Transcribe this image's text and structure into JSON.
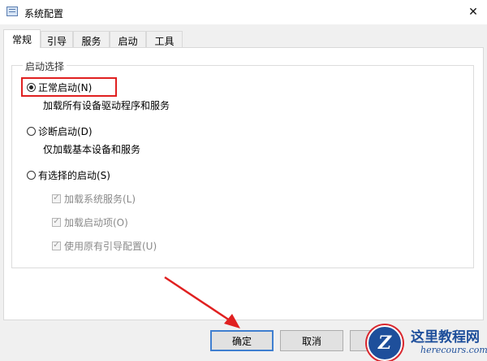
{
  "window": {
    "title": "系统配置",
    "close_glyph": "✕"
  },
  "tabs": [
    {
      "label": "常规",
      "active": true
    },
    {
      "label": "引导",
      "active": false
    },
    {
      "label": "服务",
      "active": false
    },
    {
      "label": "启动",
      "active": false
    },
    {
      "label": "工具",
      "active": false
    }
  ],
  "startup_selection": {
    "legend": "启动选择",
    "options": [
      {
        "label": "正常启动(N)",
        "description": "加载所有设备驱动程序和服务",
        "checked": true
      },
      {
        "label": "诊断启动(D)",
        "description": "仅加载基本设备和服务",
        "checked": false
      },
      {
        "label": "有选择的启动(S)",
        "checked": false
      }
    ],
    "sub_options": [
      {
        "label": "加载系统服务(L)",
        "checked": true,
        "disabled": true
      },
      {
        "label": "加载启动项(O)",
        "checked": true,
        "disabled": true
      },
      {
        "label": "使用原有引导配置(U)",
        "checked": true,
        "disabled": true
      }
    ]
  },
  "buttons": {
    "ok": "确定",
    "cancel": "取消",
    "apply": ""
  },
  "annotation": {
    "highlight_color": "#e02020",
    "arrow_color": "#e02020"
  },
  "watermark": {
    "logo_letter": "Z",
    "title": "这里教程网",
    "url": "herecours.com"
  },
  "colors": {
    "default_button_border": "#3f7fd0",
    "disabled_text": "#8a8a8a"
  }
}
